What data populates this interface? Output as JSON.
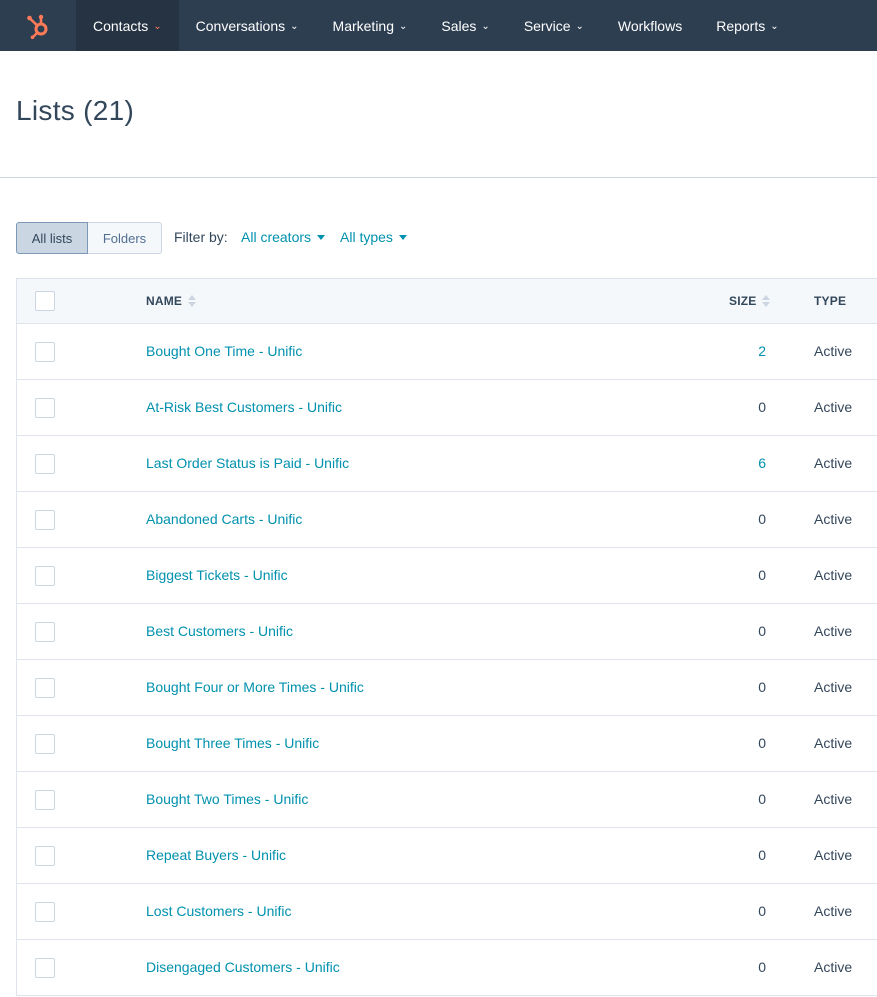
{
  "nav": {
    "items": [
      {
        "label": "Contacts",
        "active": true,
        "dropdown": true
      },
      {
        "label": "Conversations",
        "active": false,
        "dropdown": true
      },
      {
        "label": "Marketing",
        "active": false,
        "dropdown": true
      },
      {
        "label": "Sales",
        "active": false,
        "dropdown": true
      },
      {
        "label": "Service",
        "active": false,
        "dropdown": true
      },
      {
        "label": "Workflows",
        "active": false,
        "dropdown": false
      },
      {
        "label": "Reports",
        "active": false,
        "dropdown": true
      }
    ],
    "chevron": "⌄"
  },
  "page": {
    "title": "Lists (21)"
  },
  "filters": {
    "segment": {
      "all_lists": "All lists",
      "folders": "Folders"
    },
    "filter_by_label": "Filter by:",
    "creators": "All creators",
    "types": "All types"
  },
  "table": {
    "headers": {
      "name": "NAME",
      "size": "SIZE",
      "type": "TYPE"
    },
    "rows": [
      {
        "name": "Bought One Time - Unific",
        "size": "2",
        "size_link": true,
        "type": "Active"
      },
      {
        "name": "At-Risk Best Customers - Unific",
        "size": "0",
        "size_link": false,
        "type": "Active"
      },
      {
        "name": "Last Order Status is Paid - Unific",
        "size": "6",
        "size_link": true,
        "type": "Active"
      },
      {
        "name": "Abandoned Carts - Unific",
        "size": "0",
        "size_link": false,
        "type": "Active"
      },
      {
        "name": "Biggest Tickets - Unific",
        "size": "0",
        "size_link": false,
        "type": "Active"
      },
      {
        "name": "Best Customers - Unific",
        "size": "0",
        "size_link": false,
        "type": "Active"
      },
      {
        "name": "Bought Four or More Times - Unific",
        "size": "0",
        "size_link": false,
        "type": "Active"
      },
      {
        "name": "Bought Three Times - Unific",
        "size": "0",
        "size_link": false,
        "type": "Active"
      },
      {
        "name": "Bought Two Times - Unific",
        "size": "0",
        "size_link": false,
        "type": "Active"
      },
      {
        "name": "Repeat Buyers - Unific",
        "size": "0",
        "size_link": false,
        "type": "Active"
      },
      {
        "name": "Lost Customers - Unific",
        "size": "0",
        "size_link": false,
        "type": "Active"
      },
      {
        "name": "Disengaged Customers - Unific",
        "size": "0",
        "size_link": false,
        "type": "Active"
      }
    ]
  },
  "colors": {
    "nav_bg": "#2d3e50",
    "accent": "#ff7a59",
    "link": "#0091ae",
    "text": "#33475b"
  },
  "icons": {
    "logo": "hubspot-sprocket-icon"
  }
}
